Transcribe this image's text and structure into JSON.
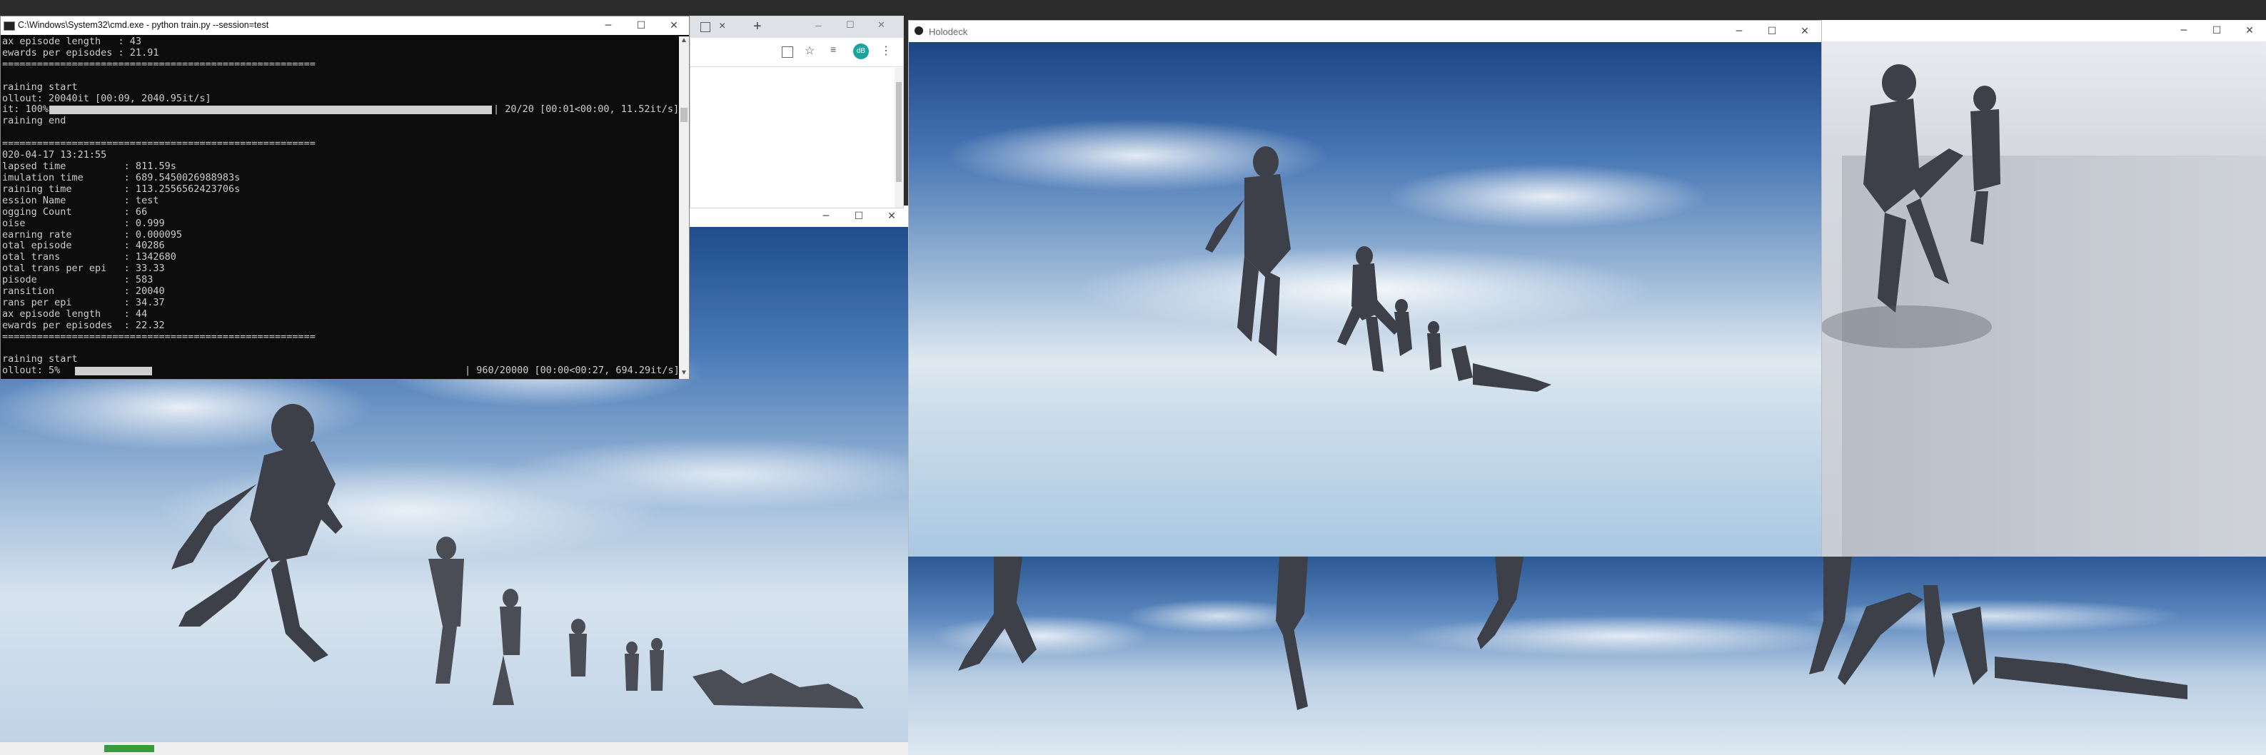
{
  "cmd_window": {
    "title": "C:\\Windows\\System32\\cmd.exe - python  train.py --session=test",
    "lines_top": [
      "ax episode length   : 43",
      "ewards per episodes : 21.91",
      "======================================================",
      "",
      "raining start",
      "ollout: 20040it [00:09, 2040.95it/s]"
    ],
    "progress_left": "it: 100%",
    "progress_right": "| 20/20 [00:01<00:00, 11.52it/s]",
    "progress_fraction": 1.0,
    "lines_bottom": [
      "raining end",
      "",
      "======================================================",
      "020-04-17 13:21:55",
      "lapsed time          : 811.59s",
      "imulation time       : 689.5450026988983s",
      "raining time         : 113.2556562423706s",
      "ession Name          : test",
      "ogging Count         : 66",
      "oise                 : 0.999",
      "earning rate         : 0.000095",
      "otal episode         : 40286",
      "otal trans           : 1342680",
      "otal trans per epi   : 33.33",
      "pisode               : 583",
      "ransition            : 20040",
      "rans per epi         : 34.37",
      "ax episode length    : 44",
      "ewards per episodes  : 22.32",
      "======================================================",
      "",
      "raining start"
    ],
    "rollout_left": "ollout:   5%",
    "rollout_right": "| 960/20000 [00:00<00:27, 694.29it/s]",
    "rollout_fraction": 0.05
  },
  "browser_window": {
    "tab_close": "×",
    "new_tab": "+",
    "avatar_text": "dB"
  },
  "holodeck_window": {
    "title": "Holodeck"
  },
  "controls": {
    "minimize": "─",
    "maximize": "☐",
    "close": "✕"
  },
  "taskbar_badge": ""
}
